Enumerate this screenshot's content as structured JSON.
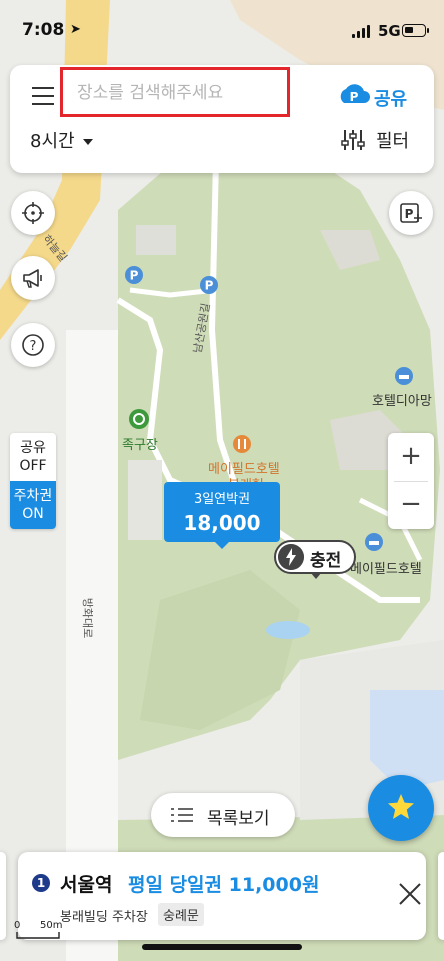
{
  "status_bar": {
    "time": "7:08",
    "network": "5G"
  },
  "search": {
    "placeholder": "장소를 검색해주세요"
  },
  "share": {
    "label": "공유"
  },
  "duration": {
    "label": "8시간"
  },
  "filter": {
    "label": "필터"
  },
  "toggles": {
    "share_label": "공유",
    "share_state": "OFF",
    "ticket_label": "주차권",
    "ticket_state": "ON"
  },
  "zoom": {
    "in": "+",
    "out": "−"
  },
  "price_marker": {
    "label": "3일연박권",
    "price": "18,000"
  },
  "charge_marker": {
    "label": "충전"
  },
  "list_view": {
    "label": "목록보기"
  },
  "map_labels": {
    "road_haneul": "하늘길",
    "road_namsan": "남산공원길",
    "road_banghwa": "방화대로",
    "place_jokgu": "족구장",
    "place_maple_hotel": "메이필드호텔",
    "place_maple_sub": "봉래헌",
    "place_hotel_diamond": "호텔디아망",
    "place_maple_hotel2": "메이필드호텔"
  },
  "bottom_card": {
    "badge": "1",
    "station": "서울역",
    "offer": "평일 당일권 11,000원",
    "lot": "봉래빌딩 주차장",
    "tag": "숭례문"
  },
  "scale": {
    "zero": "0",
    "distance": "50m"
  },
  "colors": {
    "accent": "#1a8de3",
    "highlight": "#e2262b",
    "park": "#cfdcb8"
  }
}
